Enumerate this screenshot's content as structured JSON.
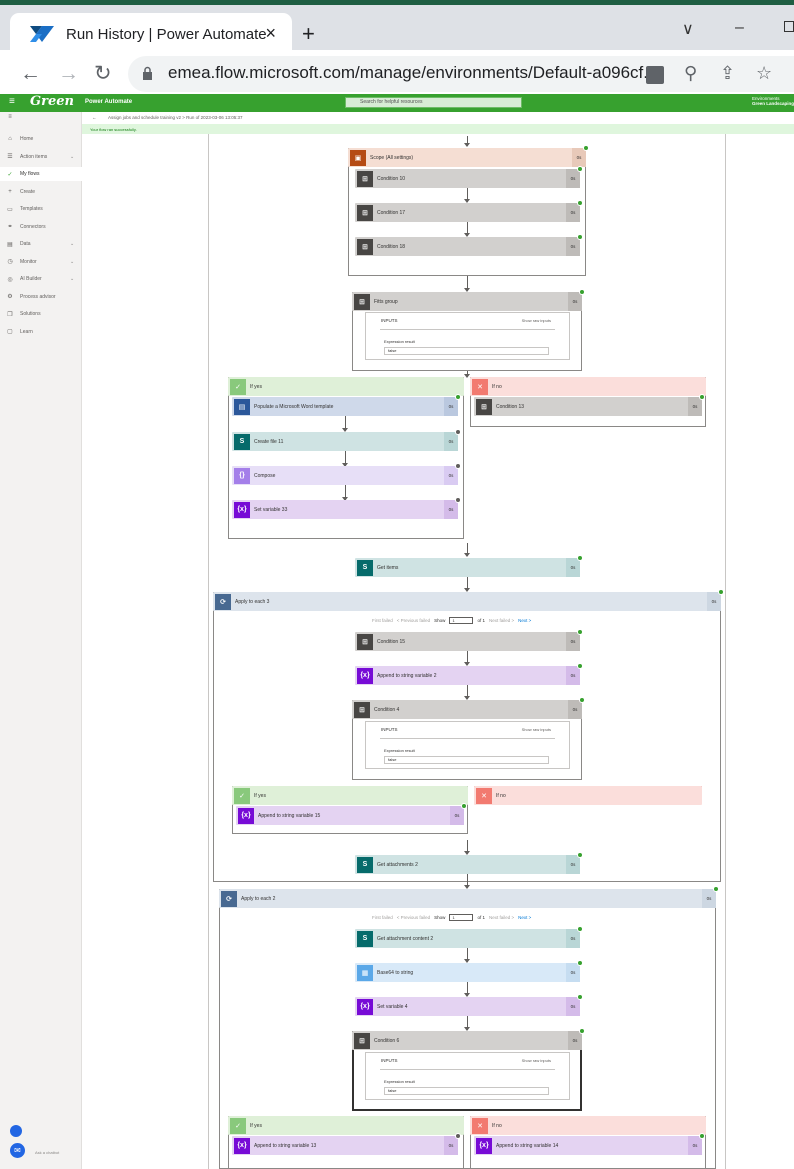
{
  "browser": {
    "tab_title": "Run History | Power Automate",
    "tab_close": "×",
    "new_tab": "+",
    "url": "emea.flow.microsoft.com/manage/environments/Default-a096cf...",
    "window_minimize": "–",
    "window_chevron": "∨"
  },
  "app": {
    "brand": "Green",
    "product": "Power Automate",
    "search_placeholder": "Search for helpful resources",
    "environment_label": "Environments",
    "environment_name": "Green Landscaping"
  },
  "left_nav": {
    "items": [
      {
        "label": "Home",
        "icon": "home-icon"
      },
      {
        "label": "Action items",
        "icon": "action-items-icon",
        "chevron": true
      },
      {
        "label": "My flows",
        "icon": "flows-icon",
        "active": true
      },
      {
        "label": "Create",
        "icon": "plus-icon"
      },
      {
        "label": "Templates",
        "icon": "templates-icon"
      },
      {
        "label": "Connectors",
        "icon": "connectors-icon"
      },
      {
        "label": "Data",
        "icon": "data-icon",
        "chevron": true
      },
      {
        "label": "Monitor",
        "icon": "monitor-icon",
        "chevron": true
      },
      {
        "label": "AI Builder",
        "icon": "ai-builder-icon",
        "chevron": true
      },
      {
        "label": "Process advisor",
        "icon": "process-advisor-icon"
      },
      {
        "label": "Solutions",
        "icon": "solutions-icon"
      },
      {
        "label": "Learn",
        "icon": "learn-icon"
      }
    ],
    "chat_label": "Ask a chatbot"
  },
  "breadcrumb": {
    "path": "Assign jobs and schedule training v2 > Run of 2023-03-06 13:05:37",
    "right": "Green"
  },
  "status": {
    "text": "Your flow ran successfully."
  },
  "flow": {
    "scope": {
      "label": "Scope (All settings)",
      "duration": "0s"
    },
    "conditions": [
      {
        "label": "Condition 10",
        "duration": "0s"
      },
      {
        "label": "Condition 17",
        "duration": "0s"
      },
      {
        "label": "Condition 18",
        "duration": "0s"
      }
    ],
    "training_cond": {
      "label": "Fitts group",
      "duration": "0s",
      "inputs": "INPUTS",
      "show_raw": "Show raw inputs",
      "expr_label": "Expression result",
      "expr_value": "false"
    },
    "yes_branch": {
      "label": "If yes"
    },
    "no_branch": {
      "label": "If no"
    },
    "yes_actions": [
      {
        "label": "Populate a Microsoft Word template",
        "duration": "0s"
      },
      {
        "label": "Create file 11",
        "duration": "0s"
      },
      {
        "label": "Compose",
        "duration": "0s"
      },
      {
        "label": "Set variable 33",
        "duration": "0s"
      }
    ],
    "no_actions": [
      {
        "label": "Condition 13",
        "duration": "0s"
      }
    ],
    "get_items": {
      "label": "Get items",
      "duration": "0s"
    },
    "apply1": {
      "label": "Apply to each 3",
      "duration": "0s"
    },
    "pager1": {
      "first": "First failed",
      "prev": "< Previous failed",
      "show": "Show",
      "value": "1",
      "of": "of 1",
      "next_failed": "Next failed >",
      "next": "Next >"
    },
    "apply1_actions": [
      {
        "label": "Condition 15",
        "duration": "0s"
      },
      {
        "label": "Append to string variable 2",
        "duration": "0s"
      },
      {
        "label": "Condition 4",
        "duration": "0s",
        "inputs": "INPUTS",
        "show_raw": "Show raw inputs",
        "expr_label": "Expression result",
        "expr_value": "false"
      }
    ],
    "yes2": {
      "label": "If yes"
    },
    "no2": {
      "label": "If no"
    },
    "yes2_action": {
      "label": "Append to string variable 15",
      "duration": "0s"
    },
    "get_attach": {
      "label": "Get attachments 2",
      "duration": "0s"
    },
    "apply2": {
      "label": "Apply to each 2",
      "duration": "0s"
    },
    "pager2": {
      "first": "First failed",
      "prev": "< Previous failed",
      "show": "Show",
      "value": "1",
      "of": "of 1",
      "next_failed": "Next failed >",
      "next": "Next >"
    },
    "apply2_actions": [
      {
        "label": "Get attachment content 2",
        "duration": "0s"
      },
      {
        "label": "Base64 to string",
        "duration": "0s"
      },
      {
        "label": "Set variable 4",
        "duration": "0s"
      },
      {
        "label": "Condition 6",
        "duration": "0s",
        "inputs": "INPUTS",
        "show_raw": "Show raw inputs",
        "expr_label": "Expression result",
        "expr_value": "false"
      }
    ],
    "yes3": {
      "label": "If yes",
      "action": "Append to string variable 13",
      "duration": "0s"
    },
    "no3": {
      "label": "If no",
      "action": "Append to string variable 14",
      "duration": "0s"
    }
  },
  "colors": {
    "brand_green": "#37a12f",
    "success_green": "#37a12f",
    "link_blue": "#0078d4"
  }
}
